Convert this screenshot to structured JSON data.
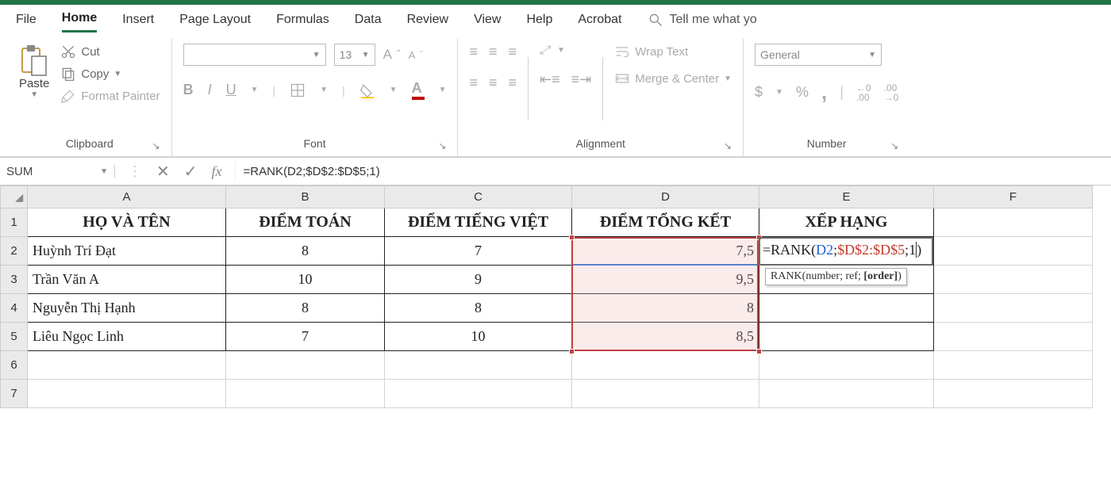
{
  "tabs": {
    "file": "File",
    "home": "Home",
    "insert": "Insert",
    "pagelayout": "Page Layout",
    "formulas": "Formulas",
    "data": "Data",
    "review": "Review",
    "view": "View",
    "help": "Help",
    "acrobat": "Acrobat",
    "tellme": "Tell me what yo"
  },
  "ribbon": {
    "clipboard": {
      "label": "Clipboard",
      "paste": "Paste",
      "cut": "Cut",
      "copy": "Copy",
      "fp": "Format Painter"
    },
    "font": {
      "label": "Font",
      "size": "13",
      "bold": "B",
      "italic": "I",
      "underline": "U"
    },
    "alignment": {
      "label": "Alignment",
      "wrap": "Wrap Text",
      "merge": "Merge & Center"
    },
    "number": {
      "label": "Number",
      "format": "General",
      "currency": "$",
      "percent": "%",
      "comma": ",",
      "inc": "←0\n.00",
      "dec": ".00\n→0"
    }
  },
  "fbar": {
    "name": "SUM",
    "fx": "fx",
    "formula": "=RANK(D2;$D$2:$D$5;1)"
  },
  "columns": [
    "A",
    "B",
    "C",
    "D",
    "E",
    "F"
  ],
  "headers": {
    "a": "HỌ VÀ TÊN",
    "b": "ĐIỂM TOÁN",
    "c": "ĐIỂM TIẾNG VIỆT",
    "d": "ĐIỂM TỔNG KẾT",
    "e": "XẾP HẠNG"
  },
  "rows": [
    {
      "a": "Huỳnh Trí Đạt",
      "b": "8",
      "c": "7",
      "d": "7,5"
    },
    {
      "a": "Trần Văn A",
      "b": "10",
      "c": "9",
      "d": "9,5"
    },
    {
      "a": "Nguyễn Thị Hạnh",
      "b": "8",
      "c": "8",
      "d": "8"
    },
    {
      "a": "Liêu Ngọc Linh",
      "b": "7",
      "c": "10",
      "d": "8,5"
    }
  ],
  "editing": {
    "prefix": "=RANK(",
    "a1": "D2",
    "sep1": ";",
    "a2": "$D$2:$D$5",
    "sep2": ";",
    "a3": "1",
    "suffix": ")",
    "tooltip": "RANK(number; ref; [order])",
    "tip_pre": "RANK(number; ref; ",
    "tip_bold": "[order]",
    "tip_post": ")"
  }
}
